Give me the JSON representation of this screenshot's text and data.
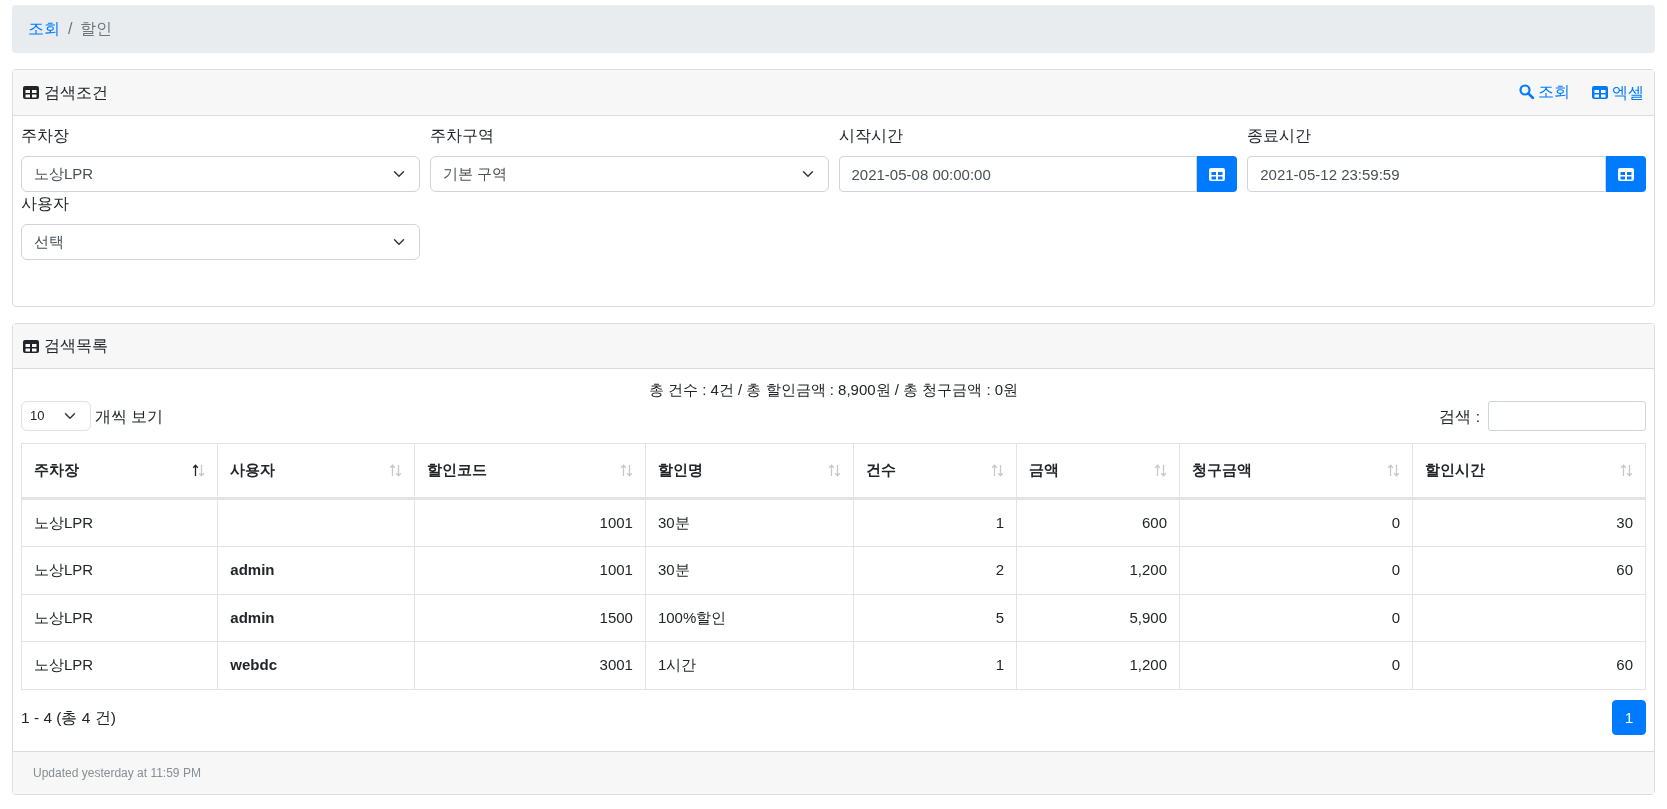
{
  "breadcrumb": {
    "separator": "/",
    "items": [
      {
        "label": "조회",
        "current": false
      },
      {
        "label": "할인",
        "current": true
      }
    ]
  },
  "search_card": {
    "title": "검색조건",
    "actions": [
      {
        "label": "조회",
        "kind": "search"
      },
      {
        "label": "엑셀",
        "kind": "table"
      }
    ],
    "fields": [
      {
        "label": "주차장",
        "kind": "select",
        "value": "노상LPR"
      },
      {
        "label": "주차구역",
        "kind": "select",
        "value": "기본 구역"
      },
      {
        "label": "시작시간",
        "kind": "date",
        "value": "2021-05-08 00:00:00"
      },
      {
        "label": "종료시간",
        "kind": "date",
        "value": "2021-05-12 23:59:59"
      },
      {
        "label": "사용자",
        "kind": "select",
        "value": "선택"
      }
    ]
  },
  "list_card": {
    "title": "검색목록",
    "summary": "총 건수 : 4건 / 총 할인금액 : 8,900원 / 총 청구금액 : 0원",
    "page_size": {
      "value": "10",
      "label": "개씩 보기"
    },
    "search_label": "검색 :",
    "table": {
      "columns": [
        {
          "label": "주차장",
          "numeric": false,
          "sorted": true
        },
        {
          "label": "사용자",
          "numeric": false,
          "sorted": false
        },
        {
          "label": "할인코드",
          "numeric": true,
          "sorted": false
        },
        {
          "label": "할인명",
          "numeric": false,
          "sorted": false
        },
        {
          "label": "건수",
          "numeric": true,
          "sorted": false
        },
        {
          "label": "금액",
          "numeric": true,
          "sorted": false
        },
        {
          "label": "청구금액",
          "numeric": true,
          "sorted": false
        },
        {
          "label": "할인시간",
          "numeric": true,
          "sorted": false
        }
      ],
      "rows": [
        [
          "노상LPR",
          null,
          "1001",
          "30분",
          "1",
          "600",
          "0",
          "30"
        ],
        [
          "노상LPR",
          "admin",
          "1001",
          "30분",
          "2",
          "1,200",
          "0",
          "60"
        ],
        [
          "노상LPR",
          "admin",
          "1500",
          "100%할인",
          "5",
          "5,900",
          "0",
          null
        ],
        [
          "노상LPR",
          "webdc",
          "3001",
          "1시간",
          "1",
          "1,200",
          "0",
          "60"
        ]
      ]
    },
    "range_info": "1 - 4 (총 4 건)",
    "pages": [
      {
        "label": "1",
        "selected": true
      }
    ],
    "footer": "Updated yesterday at 11:59 PM"
  }
}
